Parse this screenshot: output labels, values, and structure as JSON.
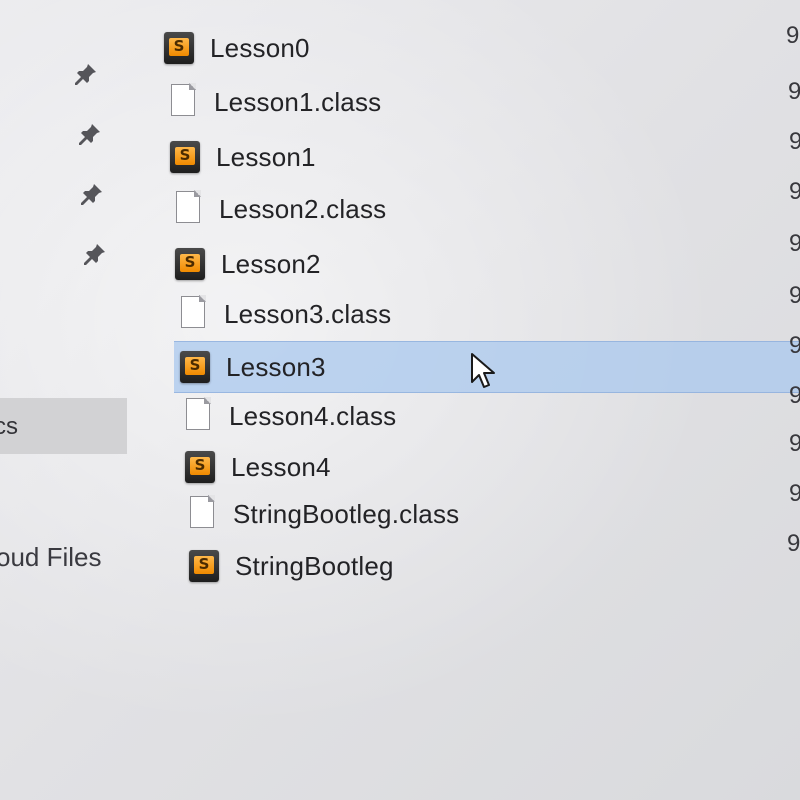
{
  "nav_pane": {
    "pinned_count": 4,
    "selected_item_label": "cs",
    "cloud_item_label": "oud Files"
  },
  "files": [
    {
      "name": "Lesson0",
      "type": "sublime",
      "selected": false,
      "date": "9"
    },
    {
      "name": "Lesson1.class",
      "type": "class",
      "selected": false,
      "date": "9"
    },
    {
      "name": "Lesson1",
      "type": "sublime",
      "selected": false,
      "date": "9"
    },
    {
      "name": "Lesson2.class",
      "type": "class",
      "selected": false,
      "date": "9"
    },
    {
      "name": "Lesson2",
      "type": "sublime",
      "selected": false,
      "date": "9"
    },
    {
      "name": "Lesson3.class",
      "type": "class",
      "selected": false,
      "date": "9"
    },
    {
      "name": "Lesson3",
      "type": "sublime",
      "selected": true,
      "date": "9"
    },
    {
      "name": "Lesson4.class",
      "type": "class",
      "selected": false,
      "date": "9"
    },
    {
      "name": "Lesson4",
      "type": "sublime",
      "selected": false,
      "date": "9"
    },
    {
      "name": "StringBootleg.class",
      "type": "class",
      "selected": false,
      "date": "9"
    },
    {
      "name": "StringBootleg",
      "type": "sublime",
      "selected": false,
      "date": "9"
    }
  ],
  "icons": {
    "pin": "pin-icon",
    "sublime_file": "sublime-text-file-icon",
    "class_file": "blank-document-icon",
    "cursor": "mouse-pointer-icon"
  },
  "colors": {
    "selection_highlight": "#aac8ee",
    "nav_selected_bg": "#d2d2d4",
    "sublime_orange": "#f08a00"
  }
}
